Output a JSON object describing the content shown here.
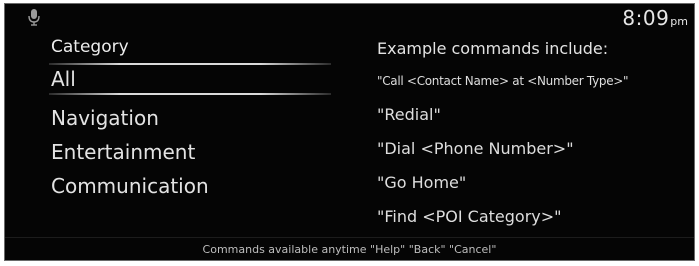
{
  "status_bar": {
    "time": "8:09",
    "ampm": "pm"
  },
  "left_panel": {
    "title": "Category",
    "items": [
      {
        "label": "All",
        "selected": true
      },
      {
        "label": "Navigation",
        "selected": false
      },
      {
        "label": "Entertainment",
        "selected": false
      },
      {
        "label": "Communication",
        "selected": false
      }
    ]
  },
  "right_panel": {
    "title": "Example commands include:",
    "commands": [
      "\"Call <Contact Name> at <Number Type>\"",
      "\"Redial\"",
      "\"Dial <Phone Number>\"",
      "\"Go Home\"",
      "\"Find <POI Category>\""
    ]
  },
  "footer": {
    "text": "Commands available anytime \"Help\" \"Back\" \"Cancel\""
  },
  "colors": {
    "background": "#050505",
    "text": "#e3e3e3",
    "border": "#6a6a6a"
  },
  "icons": {
    "mic": "microphone-icon"
  }
}
